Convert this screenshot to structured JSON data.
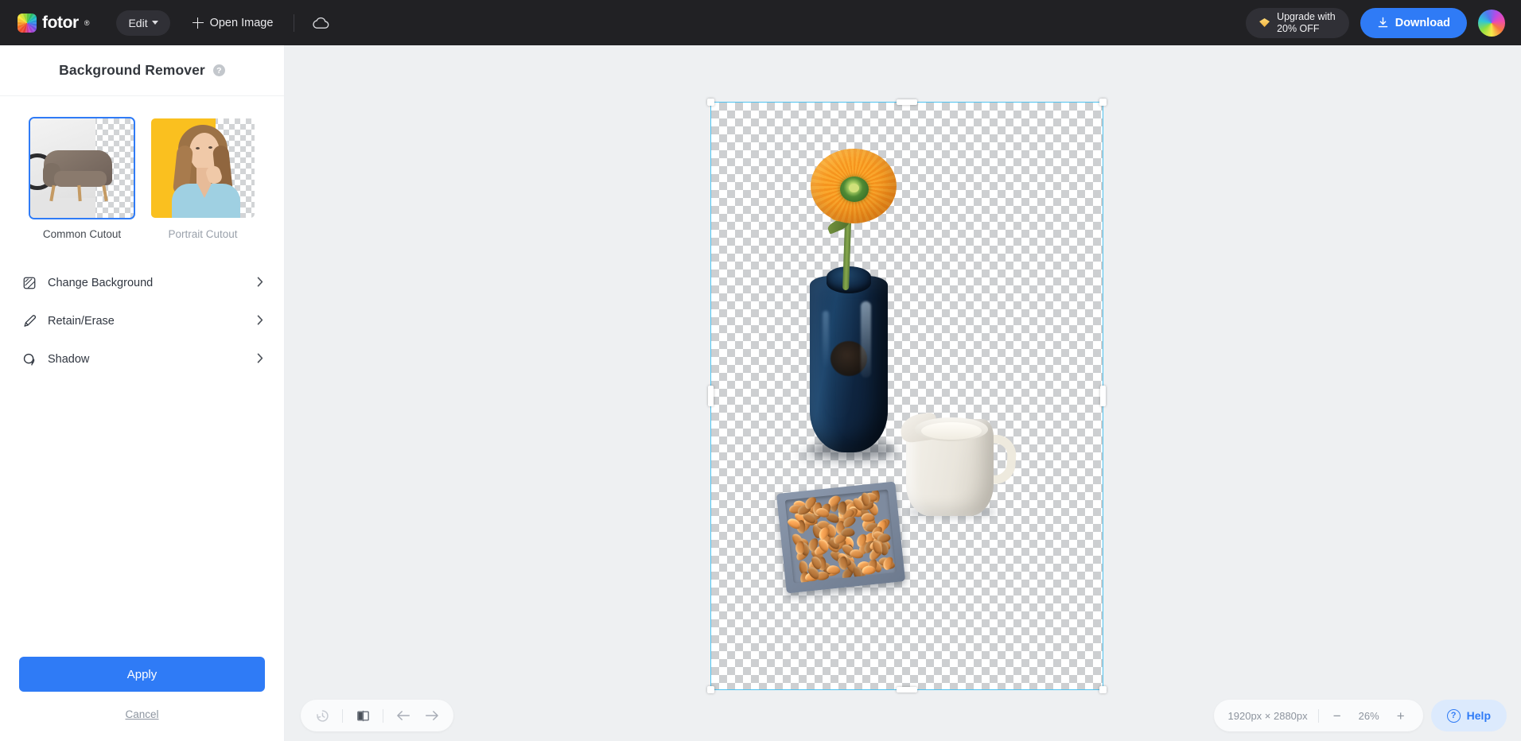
{
  "app": {
    "brand": "fotor",
    "brand_mark": "fotor-logo-icon",
    "registered": "®"
  },
  "topbar": {
    "edit_label": "Edit",
    "open_image_label": "Open Image",
    "cloud_icon": "cloud-icon",
    "upgrade_line1": "Upgrade with",
    "upgrade_line2": "20% OFF",
    "download_label": "Download",
    "avatar": "user-avatar",
    "accent_blue": "#2f7bf6",
    "bar_background": "#212124"
  },
  "panel": {
    "title": "Background Remover",
    "help_glyph": "?",
    "cutouts": [
      {
        "label": "Common Cutout",
        "selected": true
      },
      {
        "label": "Portrait Cutout",
        "selected": false
      }
    ],
    "menu": [
      {
        "label": "Change Background",
        "icon": "image-swap-icon"
      },
      {
        "label": "Retain/Erase",
        "icon": "pen-eraser-icon"
      },
      {
        "label": "Shadow",
        "icon": "shadow-icon"
      }
    ],
    "apply_label": "Apply",
    "cancel_label": "Cancel"
  },
  "toolbar": {
    "history_icon": "history-clock-icon",
    "compare_icon": "before-after-compare-icon",
    "undo_icon": "undo-arrow-icon",
    "redo_icon": "redo-arrow-icon"
  },
  "statusbar": {
    "dimensions": "1920px × 2880px",
    "zoom_out": "−",
    "zoom_level": "26%",
    "zoom_in": "+",
    "help_label": "Help",
    "help_glyph": "?"
  },
  "canvas": {
    "selection_color": "#4fc3f0",
    "background": "#eef0f2",
    "subject": "flower-vase-jug-almonds-cutout"
  }
}
